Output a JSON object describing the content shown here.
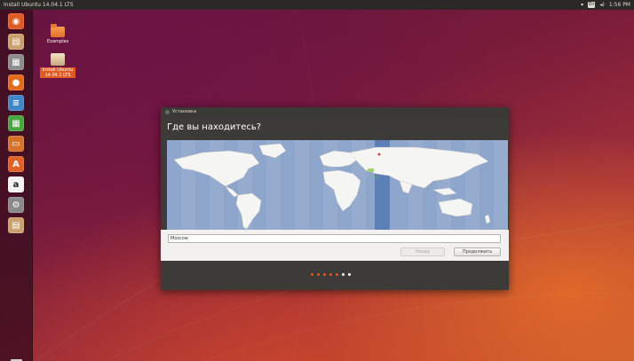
{
  "top_panel": {
    "title": "Install Ubuntu 14.04.1 LTS",
    "keyboard_layout": "En",
    "volume_icon": "volume-icon",
    "network_icon": "network-icon",
    "clock": "1:56 PM"
  },
  "launcher": {
    "items": [
      {
        "name": "dash-home",
        "icon": "ubuntu-logo-icon",
        "color": "#e05a24",
        "glyph": "◉"
      },
      {
        "name": "installer",
        "icon": "installer-icon",
        "color": "#c9a06e",
        "glyph": "▤"
      },
      {
        "name": "files",
        "icon": "file-manager-icon",
        "color": "#8c8c8c",
        "glyph": "▦"
      },
      {
        "name": "firefox",
        "icon": "firefox-icon",
        "color": "#e36b1e",
        "glyph": "●"
      },
      {
        "name": "writer",
        "icon": "libreoffice-writer-icon",
        "color": "#3f88c5",
        "glyph": "≡"
      },
      {
        "name": "calc",
        "icon": "libreoffice-calc-icon",
        "color": "#4aa642",
        "glyph": "▦"
      },
      {
        "name": "impress",
        "icon": "libreoffice-impress-icon",
        "color": "#d6732a",
        "glyph": "▭"
      },
      {
        "name": "software-center",
        "icon": "software-center-icon",
        "color": "#e0622a",
        "glyph": "A"
      },
      {
        "name": "amazon",
        "icon": "amazon-icon",
        "color": "#f2f2f2",
        "glyph": "a"
      },
      {
        "name": "settings",
        "icon": "system-settings-icon",
        "color": "#8a8a8a",
        "glyph": "⚙"
      },
      {
        "name": "installer-running",
        "icon": "installer-icon",
        "color": "#c9a06e",
        "glyph": "▤"
      }
    ],
    "trash_icon": "trash-icon"
  },
  "desktop": {
    "icons": [
      {
        "label": "Examples",
        "icon": "folder-icon"
      },
      {
        "label": "Install Ubuntu 14.04.1 LTS",
        "icon": "installer-icon"
      }
    ]
  },
  "window": {
    "title": "Установка",
    "heading": "Где вы находитесь?",
    "location_value": "Moscow",
    "back_label": "Назад",
    "continue_label": "Продолжить",
    "progress": {
      "total": 7,
      "current": 6
    }
  },
  "colors": {
    "accent": "#e05a24",
    "dot_done": "#e05a24",
    "dot_current": "#ffffff",
    "dot_pending": "#8a8985",
    "map_sea": "#8ea6cb",
    "map_land": "#f5f5f3"
  }
}
